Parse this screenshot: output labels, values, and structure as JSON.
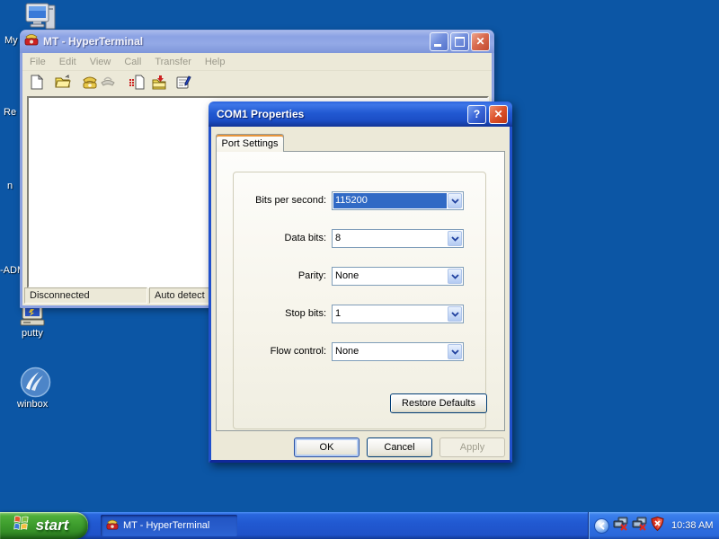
{
  "desktop": {
    "background_color": "#0c56a5",
    "icons": [
      {
        "id": "my-computer",
        "label": "My"
      },
      {
        "id": "hidden-icon-re",
        "label": "Re"
      },
      {
        "id": "hidden-icon-n",
        "label": "n"
      },
      {
        "id": "hidden-icon-adm",
        "label": "-ADM"
      },
      {
        "id": "putty",
        "label": "putty"
      },
      {
        "id": "winbox",
        "label": "winbox"
      }
    ]
  },
  "hyperterminal": {
    "title": "MT - HyperTerminal",
    "menu": [
      "File",
      "Edit",
      "View",
      "Call",
      "Transfer",
      "Help"
    ],
    "toolbar_icons": [
      "new-document",
      "open-folder",
      "call-phone",
      "hangup-phone",
      "send-text",
      "receive-file",
      "properties"
    ],
    "status": {
      "left": "Disconnected",
      "right": "Auto detect"
    }
  },
  "dialog": {
    "title": "COM1 Properties",
    "tab": "Port Settings",
    "fields": [
      {
        "label": "Bits per second:",
        "value": "115200",
        "selected": true
      },
      {
        "label": "Data bits:",
        "value": "8",
        "selected": false
      },
      {
        "label": "Parity:",
        "value": "None",
        "selected": false
      },
      {
        "label": "Stop bits:",
        "value": "1",
        "selected": false
      },
      {
        "label": "Flow control:",
        "value": "None",
        "selected": false
      }
    ],
    "restore_label": "Restore Defaults",
    "buttons": {
      "ok": "OK",
      "cancel": "Cancel",
      "apply": "Apply"
    },
    "apply_enabled": false
  },
  "taskbar": {
    "start_label": "start",
    "task_label": "MT - HyperTerminal",
    "clock": "10:38 AM",
    "tray_icons": [
      "collapse-chevron",
      "network-disconnected",
      "network-disconnected",
      "security-shield-alert"
    ]
  },
  "colors": {
    "selection_blue": "#316ac5",
    "dialog_title_blue": "#2259d2",
    "inactive_title_blue": "#8ba2e4",
    "taskbar_blue": "#2159d1",
    "start_green": "#3e9e2e",
    "desktop_blue": "#0c56a5",
    "xp_beige": "#ece9d8"
  }
}
